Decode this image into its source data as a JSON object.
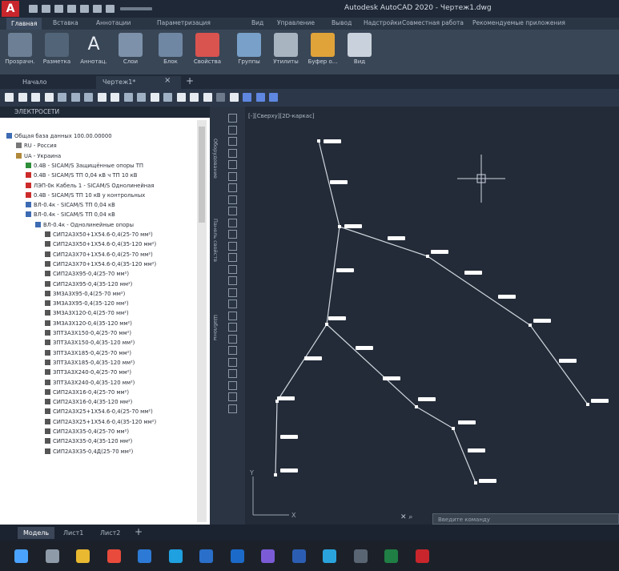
{
  "window": {
    "logo_letter": "A",
    "title": "Autodesk AutoCAD 2020 - Чертеж1.dwg"
  },
  "ribbon": {
    "tabs": [
      "Главная",
      "Вставка",
      "Аннотации",
      "Параметризация",
      "Вид",
      "Управление",
      "Вывод",
      "Надстройки",
      "Совместная работа",
      "Рекомендуемые приложения"
    ],
    "active_tab_index": 0,
    "buttons": [
      {
        "label": "Прозрачн.",
        "icon": "transparency-icon",
        "color": "#6c7f95"
      },
      {
        "label": "Разметка",
        "icon": "markup-icon",
        "color": "#526478"
      },
      {
        "label": "Аннотац.",
        "icon": "text-icon",
        "color": "#394656"
      },
      {
        "label": "Слои",
        "icon": "layers-icon",
        "color": "#7d92aa"
      },
      {
        "label": "Блок",
        "icon": "block-icon",
        "color": "#6f87a3"
      },
      {
        "label": "Свойства",
        "icon": "properties-color-wheel-icon",
        "color": "#d9534f"
      },
      {
        "label": "Группы",
        "icon": "groups-icon",
        "color": "#78a0c8"
      },
      {
        "label": "Утилиты",
        "icon": "calculator-icon",
        "color": "#a8b4c0"
      },
      {
        "label": "Буфер о...",
        "icon": "clipboard-icon",
        "color": "#e0a33a"
      },
      {
        "label": "Вид",
        "icon": "view-icon",
        "color": "#c9d1dc"
      }
    ]
  },
  "file_tabs": {
    "items": [
      "Начало",
      "Чертеж1*"
    ],
    "active_index": 1,
    "close_glyph": "×",
    "add_glyph": "+"
  },
  "tree_panel": {
    "header": "ЭЛЕКТРОСЕТИ",
    "side_labels": [
      "Оборудование",
      "Панель свойств",
      "Шаблоны"
    ],
    "items": [
      {
        "text": "Общая база данных 100.00.00000",
        "level": 0,
        "icon": "database-icon",
        "color": "#3d6bb3"
      },
      {
        "text": "RU - Россия",
        "level": 1,
        "icon": "folder-icon",
        "color": "#777777"
      },
      {
        "text": "UA - Украина",
        "level": 1,
        "icon": "folder-open-icon",
        "color": "#b0893b"
      },
      {
        "text": "0.4В - SICAM/S Защищённые опоры ТП",
        "level": 2,
        "icon": "substation-icon",
        "color": "#2f8f3a"
      },
      {
        "text": "0.4В - SICAM/S ТП 0,04 кВ ч ТП 10 кВ",
        "level": 2,
        "icon": "substation-icon",
        "color": "#cc2b2b"
      },
      {
        "text": "ЛЭП-0к Кабель 1 - SICAM/S Однолинейная",
        "level": 2,
        "icon": "substation-icon",
        "color": "#cc2b2b"
      },
      {
        "text": "0.4В - SICAM/S ТП 10 кВ у контрольных",
        "level": 2,
        "icon": "substation-icon",
        "color": "#cc2b2b"
      },
      {
        "text": "ВЛ-0.4к - SICAM/S ТП 0,04 кВ",
        "level": 2,
        "icon": "line-icon",
        "color": "#3d6bb3"
      },
      {
        "text": "ВЛ-0.4к - SICAM/S ТП 0,04 кВ",
        "level": 2,
        "icon": "line-icon",
        "color": "#3d6bb3"
      },
      {
        "text": "ВЛ-0.4к - Однолинейные опоры",
        "level": 3,
        "icon": "line-icon",
        "color": "#3d6bb3"
      },
      {
        "text": "СИП2А3Х50+1Х54.6-0,4(25-70 мм²)",
        "level": 4,
        "icon": "cable-icon",
        "color": "#555555"
      },
      {
        "text": "СИП2А3Х50+1Х54.6-0,4(35-120 мм²)",
        "level": 4,
        "icon": "cable-icon",
        "color": "#555555"
      },
      {
        "text": "СИП2А3Х70+1Х54.6-0,4(25-70 мм²)",
        "level": 4,
        "icon": "cable-icon",
        "color": "#555555"
      },
      {
        "text": "СИП2А3Х70+1Х54.6-0,4(35-120 мм²)",
        "level": 4,
        "icon": "cable-icon",
        "color": "#555555"
      },
      {
        "text": "СИП2А3Х95-0,4(25-70 мм²)",
        "level": 4,
        "icon": "cable-icon",
        "color": "#555555"
      },
      {
        "text": "СИП2А3Х95-0,4(35-120 мм²)",
        "level": 4,
        "icon": "cable-icon",
        "color": "#555555"
      },
      {
        "text": "ЗМ3А3Х95-0,4(25-70 мм²)",
        "level": 4,
        "icon": "cable-icon",
        "color": "#555555"
      },
      {
        "text": "ЗМ3А3Х95-0,4(35-120 мм²)",
        "level": 4,
        "icon": "cable-icon",
        "color": "#555555"
      },
      {
        "text": "ЗМ3А3Х120-0,4(25-70 мм²)",
        "level": 4,
        "icon": "cable-icon",
        "color": "#555555"
      },
      {
        "text": "ЗМ3А3Х120-0,4(35-120 мм²)",
        "level": 4,
        "icon": "cable-icon",
        "color": "#555555"
      },
      {
        "text": "ЗПТ3А3Х150-0,4(25-70 мм²)",
        "level": 4,
        "icon": "cable-icon",
        "color": "#555555"
      },
      {
        "text": "ЗПТ3А3Х150-0,4(35-120 мм²)",
        "level": 4,
        "icon": "cable-icon",
        "color": "#555555"
      },
      {
        "text": "ЗПТ3А3Х185-0,4(25-70 мм²)",
        "level": 4,
        "icon": "cable-icon",
        "color": "#555555"
      },
      {
        "text": "ЗПТ3А3Х185-0,4(35-120 мм²)",
        "level": 4,
        "icon": "cable-icon",
        "color": "#555555"
      },
      {
        "text": "ЗПТ3А3Х240-0,4(25-70 мм²)",
        "level": 4,
        "icon": "cable-icon",
        "color": "#555555"
      },
      {
        "text": "ЗПТ3А3Х240-0,4(35-120 мм²)",
        "level": 4,
        "icon": "cable-icon",
        "color": "#555555"
      },
      {
        "text": "СИП2А3Х16-0,4(25-70 мм²)",
        "level": 4,
        "icon": "cable-icon",
        "color": "#555555"
      },
      {
        "text": "СИП2А3Х16-0,4(35-120 мм²)",
        "level": 4,
        "icon": "cable-icon",
        "color": "#555555"
      },
      {
        "text": "СИП2А3Х25+1Х54.6-0,4(25-70 мм²)",
        "level": 4,
        "icon": "cable-icon",
        "color": "#555555"
      },
      {
        "text": "СИП2А3Х25+1Х54.6-0,4(35-120 мм²)",
        "level": 4,
        "icon": "cable-icon",
        "color": "#555555"
      },
      {
        "text": "СИП2А3Х35-0,4(25-70 мм²)",
        "level": 4,
        "icon": "cable-icon",
        "color": "#555555"
      },
      {
        "text": "СИП2А3Х35-0,4(35-120 мм²)",
        "level": 4,
        "icon": "cable-icon",
        "color": "#555555"
      },
      {
        "text": "СИП2А3Х35-0,4Д(25-70 мм²)",
        "level": 4,
        "icon": "cable-icon",
        "color": "#555555"
      }
    ]
  },
  "drawing": {
    "viewport_label": "[-][Сверху][2D-каркас]",
    "line_color": "#d0d6de",
    "label_color": "#ffffff",
    "pole_label": "▬▬▬",
    "ucs_x": "X",
    "ucs_y": "Y",
    "command_placeholder": "Введите команду",
    "command_icons": "✕ ⌕"
  },
  "layout_tabs": {
    "items": [
      "Модель",
      "Лист1",
      "Лист2"
    ],
    "active_index": 0,
    "add_glyph": "+"
  },
  "taskbar": {
    "apps": [
      {
        "name": "start-icon",
        "color": "#4aa3ff"
      },
      {
        "name": "search-icon",
        "color": "#8e9aa8"
      },
      {
        "name": "file-explorer-icon",
        "color": "#e8b931"
      },
      {
        "name": "chrome-icon",
        "color": "#e84b3c"
      },
      {
        "name": "mail-icon",
        "color": "#2d7ad6"
      },
      {
        "name": "edge-icon",
        "color": "#1fa0e0"
      },
      {
        "name": "store-icon",
        "color": "#2a6fc9"
      },
      {
        "name": "outlook-icon",
        "color": "#1b6ac9"
      },
      {
        "name": "viber-icon",
        "color": "#7b5cd6"
      },
      {
        "name": "word-icon",
        "color": "#2b5eb3"
      },
      {
        "name": "telegram-icon",
        "color": "#2aa3dd"
      },
      {
        "name": "calculator-icon",
        "color": "#5a6573"
      },
      {
        "name": "excel-icon",
        "color": "#1f7f44"
      },
      {
        "name": "autocad-icon",
        "color": "#c8262c"
      }
    ]
  }
}
